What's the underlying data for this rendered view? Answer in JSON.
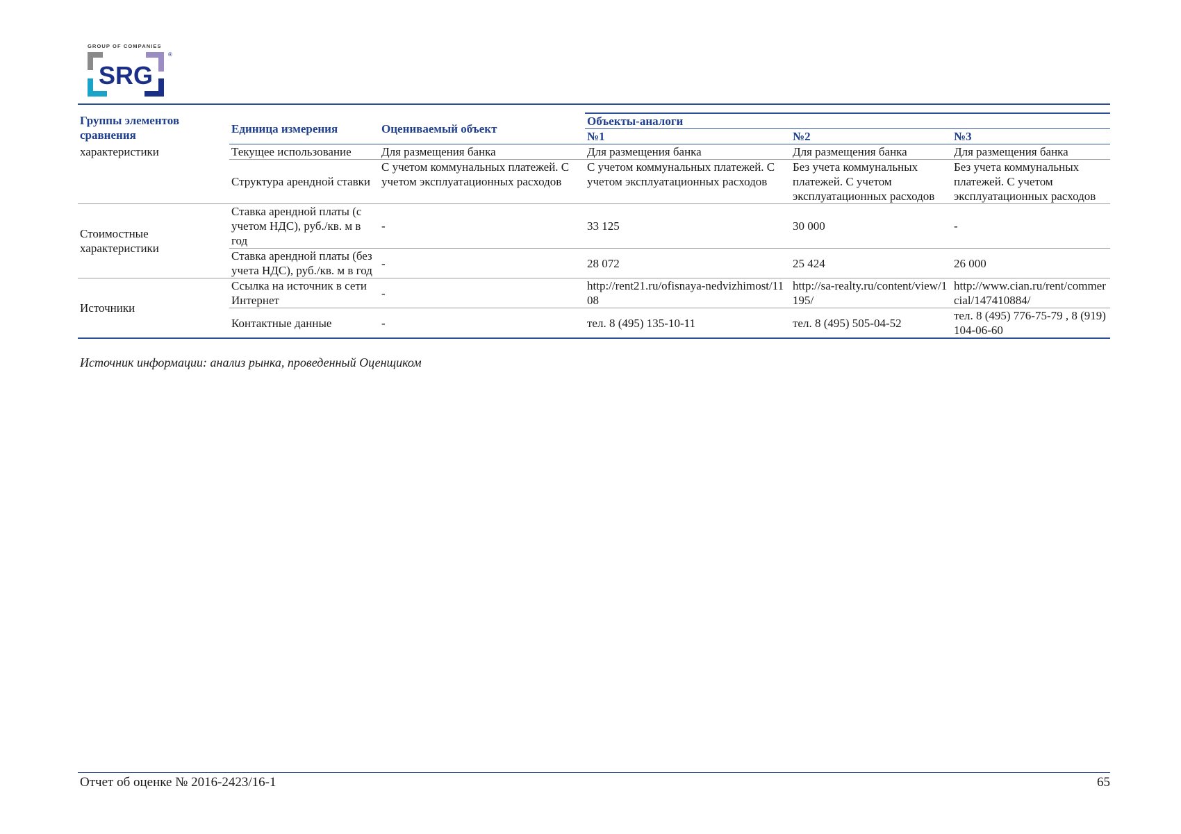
{
  "logo": {
    "tagline": "GROUP OF COMPANIES",
    "brand": "SRG",
    "mark": "®",
    "colors": {
      "frame_left": "#8a8a8a",
      "frame_right": "#9b8cc4",
      "bottom_left": "#1aa3c8",
      "bottom_right": "#1c2f86",
      "text": "#1c2f86"
    }
  },
  "table": {
    "header": {
      "groups": "Группы элементов сравнения",
      "unit": "Единица измерения",
      "object": "Оцениваемый объект",
      "analogs": "Объекты-аналоги",
      "analog1": "№1",
      "analog2": "№2",
      "analog3": "№3"
    },
    "group1": {
      "label": "характеристики",
      "rows": [
        {
          "unit": "Текущее использование",
          "object": "Для размещения банка",
          "a1": "Для размещения банка",
          "a2": "Для размещения банка",
          "a3": "Для размещения банка"
        },
        {
          "unit": "Структура арендной ставки",
          "object": "С учетом коммунальных платежей. С учетом эксплуатационных расходов",
          "a1": "С учетом коммунальных платежей. С учетом эксплуатационных расходов",
          "a2": "Без учета коммунальных платежей. С учетом эксплуатационных расходов",
          "a3": "Без учета коммунальных платежей. С учетом эксплуатационных расходов"
        }
      ]
    },
    "group2": {
      "label": "Стоимостные характеристики",
      "rows": [
        {
          "unit": "Ставка арендной платы (с учетом НДС), руб./кв. м в год",
          "object": "-",
          "a1": "33 125",
          "a2": "30 000",
          "a3": "-"
        },
        {
          "unit": "Ставка арендной платы (без учета НДС), руб./кв. м в год",
          "object": "-",
          "a1": "28 072",
          "a2": "25 424",
          "a3": "26 000"
        }
      ]
    },
    "group3": {
      "label": "Источники",
      "rows": [
        {
          "unit": "Ссылка на источник в сети Интернет",
          "object": "-",
          "a1": "http://rent21.ru/ofisnaya-nedvizhimost/1108",
          "a2": "http://sa-realty.ru/content/view/1195/",
          "a3": "http://www.cian.ru/rent/commercial/147410884/"
        },
        {
          "unit": "Контактные данные",
          "object": "-",
          "a1": "тел. 8 (495) 135-10-11",
          "a2": "тел. 8 (495) 505-04-52",
          "a3": "тел. 8 (495) 776-75-79 , 8 (919) 104-06-60"
        }
      ]
    }
  },
  "source_note": "Источник информации: анализ рынка, проведенный Оценщиком",
  "footer": {
    "report": "Отчет об оценке № 2016-2423/16-1",
    "page": "65"
  },
  "colors": {
    "accent": "#2b4e97",
    "header_text": "#1f3f8f"
  }
}
